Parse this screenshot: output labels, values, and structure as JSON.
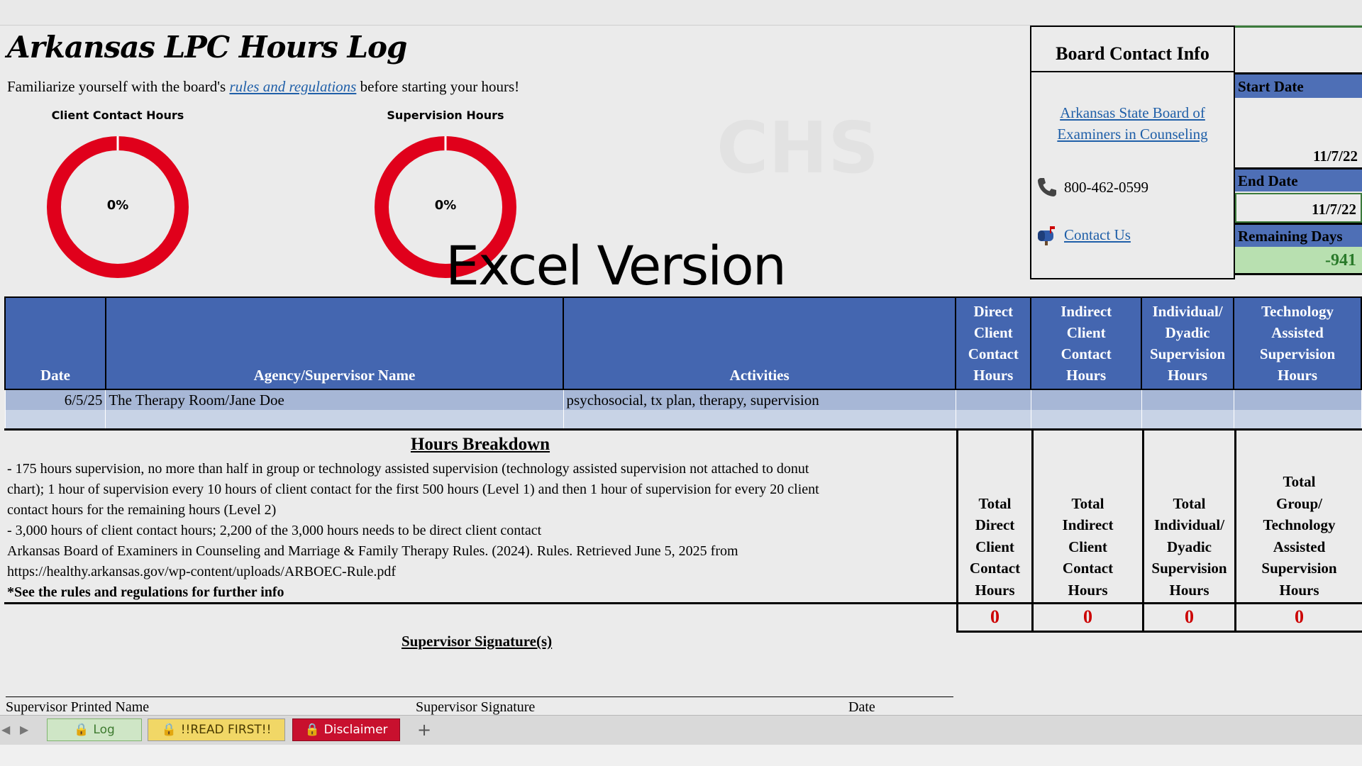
{
  "title": "Arkansas LPC Hours Log",
  "intro": {
    "prefix": "Familiarize yourself with the board's ",
    "link": "rules and regulations",
    "suffix": " before starting your hours!"
  },
  "donuts": [
    {
      "title": "Client Contact Hours",
      "percent_label": "0%",
      "percent": 0,
      "color": "#e0001b"
    },
    {
      "title": "Supervision Hours",
      "percent_label": "0%",
      "percent": 0,
      "color": "#e0001b"
    }
  ],
  "overlay_text": "Excel Version",
  "board": {
    "title": "Board Contact Info",
    "link_line1": "Arkansas State Board of",
    "link_line2": "Examiners in Counseling",
    "phone_icon": "phone-icon",
    "phone": "800-462-0599",
    "contact_icon": "mailbox-icon",
    "contact": "Contact Us"
  },
  "dates": {
    "start_label": "Start Date",
    "start_value": "11/7/22",
    "end_label": "End Date",
    "end_value": "11/7/22",
    "remaining_label": "Remaining Days",
    "remaining_value": "-941"
  },
  "log_table": {
    "headers": [
      [
        "Date"
      ],
      [
        "Agency/Supervisor Name"
      ],
      [
        "Activities"
      ],
      [
        "Direct",
        "Client",
        "Contact",
        "Hours"
      ],
      [
        "Indirect",
        "Client",
        "Contact",
        "Hours"
      ],
      [
        "Individual/",
        "Dyadic",
        "Supervision",
        "Hours"
      ],
      [
        "Technology",
        "Assisted",
        "Supervision",
        "Hours"
      ]
    ],
    "rows": [
      {
        "date": "6/5/25",
        "agency": "The Therapy Room/Jane Doe",
        "activities": "psychosocial, tx plan, therapy, supervision",
        "direct": "",
        "indirect": "",
        "individual": "",
        "technology": ""
      },
      {
        "date": "",
        "agency": "",
        "activities": "",
        "direct": "",
        "indirect": "",
        "individual": "",
        "technology": ""
      }
    ]
  },
  "breakdown": {
    "title": "Hours Breakdown",
    "lines": [
      "- 175 hours supervision, no more than half in group or technology assisted supervision (technology assisted supervision not attached to donut",
      "chart); 1 hour of supervision every 10 hours of client contact for the first 500 hours (Level 1) and then 1 hour of supervision for every 20 client",
      "contact hours for the remaining hours (Level 2)",
      "- 3,000 hours of client contact hours; 2,200 of the 3,000 hours needs to be direct client contact",
      "Arkansas Board of Examiners in Counseling and Marriage & Family Therapy Rules. (2024). Rules. Retrieved June 5, 2025 from",
      "https://healthy.arkansas.gov/wp-content/uploads/ARBOEC-Rule.pdf"
    ],
    "note": "*See the rules and regulations for further info"
  },
  "totals": [
    {
      "label": [
        "Total",
        "Direct",
        "Client",
        "Contact",
        "Hours"
      ],
      "value": "0"
    },
    {
      "label": [
        "Total",
        "Indirect",
        "Client",
        "Contact",
        "Hours"
      ],
      "value": "0"
    },
    {
      "label": [
        "Total",
        "Individual/",
        "Dyadic",
        "Supervision",
        "Hours"
      ],
      "value": "0"
    },
    {
      "label": [
        "Total",
        "Group/",
        "Technology",
        "Assisted",
        "Supervision",
        "Hours"
      ],
      "value": "0"
    }
  ],
  "signature": {
    "title": "Supervisor Signature(s)",
    "printed_name": "Supervisor Printed Name",
    "signature": "Supervisor Signature",
    "date": "Date"
  },
  "sheet_tabs": [
    {
      "label": "Log",
      "icon": "lock-icon",
      "bg": "#cfe6c6",
      "fg": "#3d7a2f"
    },
    {
      "label": "!!READ FIRST!!",
      "icon": "lock-icon",
      "bg": "#f1d766",
      "fg": "#4a3b00"
    },
    {
      "label": "Disclaimer",
      "icon": "lock-icon",
      "bg": "#c8102e",
      "fg": "#ffffff"
    }
  ],
  "add_sheet": "+"
}
